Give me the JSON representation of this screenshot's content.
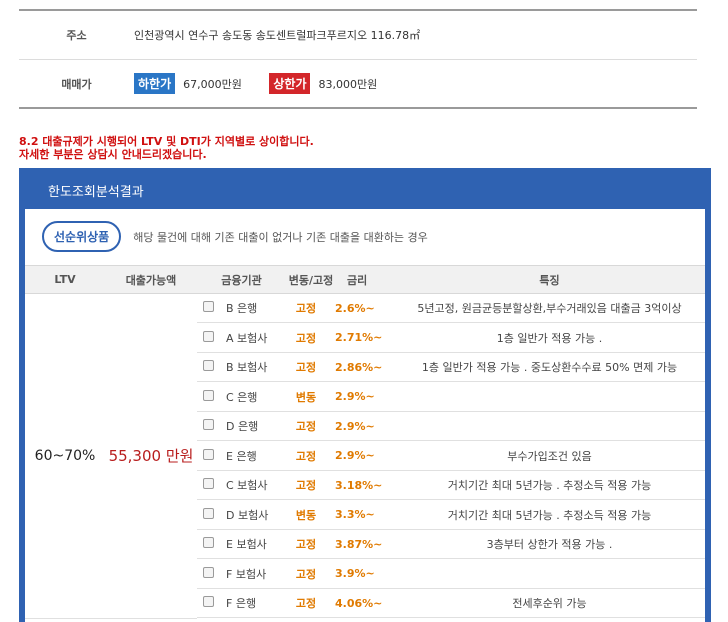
{
  "property": {
    "address_label": "주소",
    "address_value": "인천광역시 연수구 송도동 송도센트럴파크푸르지오 116.78㎡",
    "price_label": "매매가",
    "low_tag": "하한가",
    "low_price": "67,000만원",
    "high_tag": "상한가",
    "high_price": "83,000만원"
  },
  "notice": {
    "line1": "8.2 대출규제가 시행되어 LTV 및 DTI가 지역별로 상이합니다.",
    "line2": "자세한 부분은 상담시 안내드리겠습니다."
  },
  "panel": {
    "title": "한도조회분석결과",
    "product_badge": "선순위상품",
    "product_desc": "해당 물건에 대해 기존 대출이 없거나 기존 대출을 대환하는 경우"
  },
  "table": {
    "headers": {
      "ltv": "LTV",
      "amount": "대출가능액",
      "institution": "금융기관",
      "type": "변동/고정",
      "rate": "금리",
      "feature": "특징"
    },
    "ltv_value": "60~70%",
    "amount_value": "55,300 만원",
    "rows": [
      {
        "institution": "B 은행",
        "type": "고정",
        "rate": "2.6%~",
        "feature": "5년고정, 원금균등분할상환,부수거래있음 대출금 3억이상"
      },
      {
        "institution": "A 보험사",
        "type": "고정",
        "rate": "2.71%~",
        "feature": "1층 일반가 적용 가능 ."
      },
      {
        "institution": "B 보험사",
        "type": "고정",
        "rate": "2.86%~",
        "feature": "1층 일반가 적용 가능 . 중도상환수수료 50% 면제 가능"
      },
      {
        "institution": "C 은행",
        "type": "변동",
        "rate": "2.9%~",
        "feature": ""
      },
      {
        "institution": "D 은행",
        "type": "고정",
        "rate": "2.9%~",
        "feature": ""
      },
      {
        "institution": "E 은행",
        "type": "고정",
        "rate": "2.9%~",
        "feature": "부수가입조건 있음"
      },
      {
        "institution": "C 보험사",
        "type": "고정",
        "rate": "3.18%~",
        "feature": "거치기간 최대 5년가능 . 추정소득 적용 가능"
      },
      {
        "institution": "D 보험사",
        "type": "변동",
        "rate": "3.3%~",
        "feature": "거치기간 최대 5년가능 . 추정소득 적용 가능"
      },
      {
        "institution": "E 보험사",
        "type": "고정",
        "rate": "3.87%~",
        "feature": "3층부터 상한가 적용 가능 ."
      },
      {
        "institution": "F 보험사",
        "type": "고정",
        "rate": "3.9%~",
        "feature": ""
      },
      {
        "institution": "F 은행",
        "type": "고정",
        "rate": "4.06%~",
        "feature": "전세후순위 가능"
      }
    ]
  }
}
